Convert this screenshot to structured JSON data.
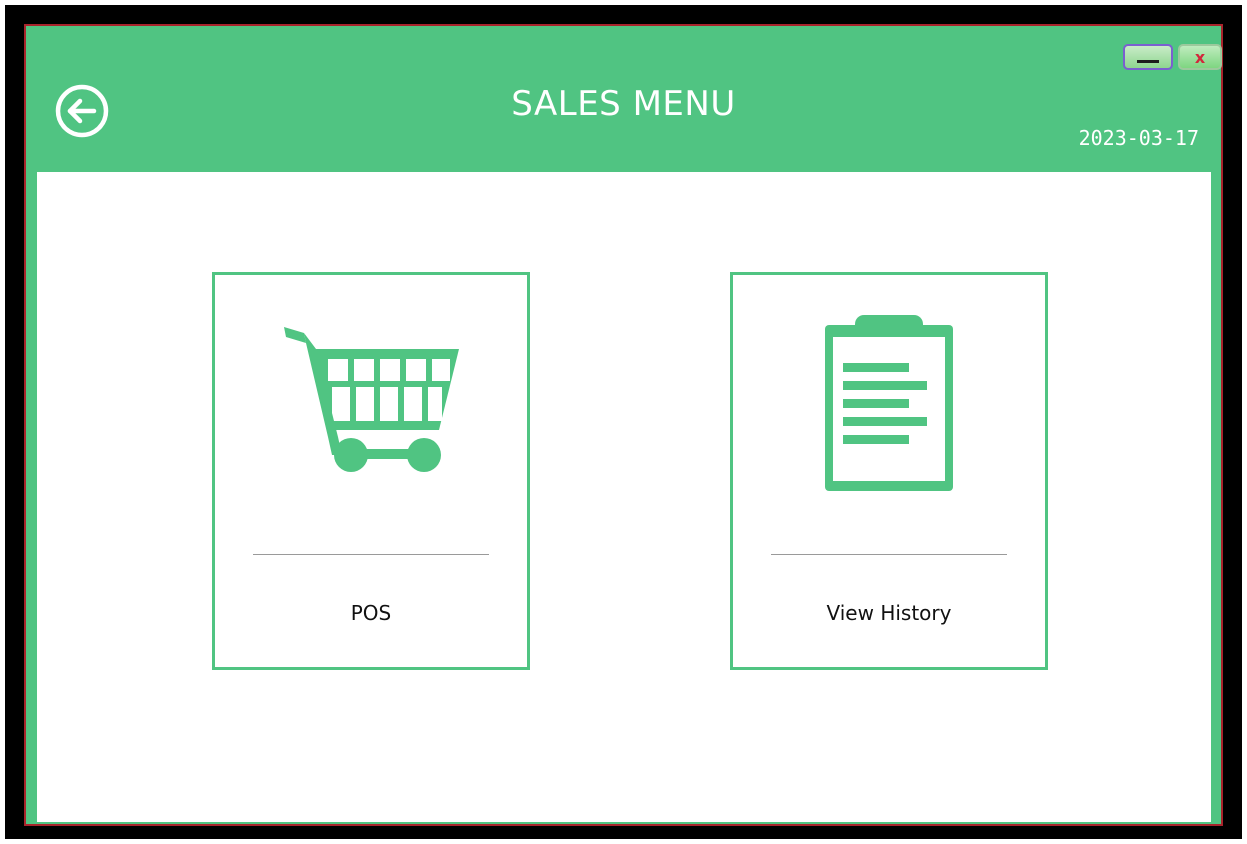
{
  "header": {
    "title": "SALES MENU",
    "date": "2023-03-17",
    "back_icon": "arrow-left-circle-icon"
  },
  "window_controls": {
    "minimize_symbol": "—",
    "close_symbol": "x"
  },
  "menu": {
    "items": [
      {
        "label": "POS",
        "icon": "shopping-cart-icon"
      },
      {
        "label": "View History",
        "icon": "clipboard-icon"
      }
    ]
  },
  "colors": {
    "accent": "#50c482",
    "background": "#ffffff",
    "frame_border": "#a8242c",
    "close_x": "#d2283c"
  }
}
